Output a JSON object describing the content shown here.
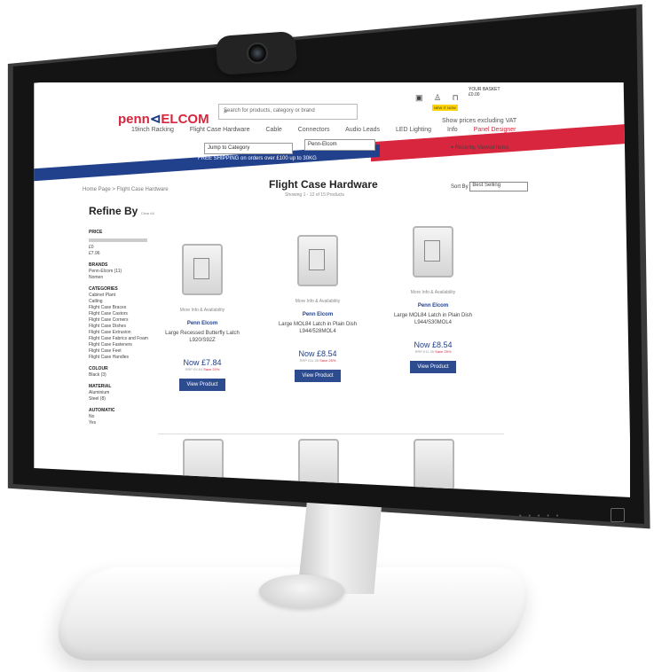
{
  "header": {
    "search_placeholder": "Search for products, category or brand",
    "basket_label": "YOUR BASKET",
    "basket_total": "£0.00",
    "new_badge": "NEW IT NOW",
    "vat_label": "Show prices excluding VAT",
    "recent_label": "▾ Recently Viewed Items"
  },
  "nav": {
    "items": [
      "19inch Racking",
      "Flight Case Hardware",
      "Cable",
      "Connectors",
      "Audio Leads",
      "LED Lighting",
      "Info",
      "Panel Designer"
    ],
    "category_select": "Jump to Category",
    "brand_select": "Penn-Elcom"
  },
  "banner": {
    "text": "FREE SHIPPING on orders over £100 up to 30KG"
  },
  "breadcrumb": "Home Page > Flight Case Hardware",
  "sidebar": {
    "title": "Refine By",
    "clear": "Clear All",
    "sections": [
      {
        "heading": "PRICE",
        "lines": [
          "£0",
          "£7.96"
        ]
      },
      {
        "heading": "BRANDS",
        "lines": [
          "Penn-Elcom (11)",
          "Nomen"
        ]
      },
      {
        "heading": "CATEGORIES",
        "lines": [
          "Cabinet Plant",
          "Catling",
          "Flight Case Braces",
          "Flight Case Castors",
          "Flight Case Corners",
          "Flight Case Dishes",
          "Flight Case Extrusion",
          "Flight Case Fabrics and Foam",
          "Flight Case Fasteners",
          "Flight Case Feet",
          "Flight Case Handles"
        ]
      },
      {
        "heading": "COLOUR",
        "lines": [
          "Black (3)"
        ]
      },
      {
        "heading": "MATERIAL",
        "lines": [
          "Aluminium",
          "Steel (8)"
        ]
      },
      {
        "heading": "AUTOMATIC",
        "lines": [
          "No",
          "Yes"
        ]
      }
    ]
  },
  "main": {
    "title": "Flight Case Hardware",
    "showing": "Showing 1 - 12 of 15 Products",
    "sort_label": "Sort By",
    "sort_value": "Best Selling"
  },
  "products": [
    {
      "more": "More Info & Availability",
      "brand": "Penn Elcom",
      "name": "Large Recessed Butterfly Latch L920/S92Z",
      "price": "Now £7.84",
      "rrp": "RRP £9.84",
      "save": "Save 20%",
      "cta": "View Product"
    },
    {
      "more": "More Info & Availability",
      "brand": "Penn Elcom",
      "name": "Large MOL84 Latch in Plain Dish L944/528MOL4",
      "price": "Now £8.54",
      "rrp": "RRP £11.35",
      "save": "Save 25%",
      "cta": "View Product"
    },
    {
      "more": "More Info & Availability",
      "brand": "Penn Elcom",
      "name": "Large MOL84 Latch in Plain Dish L944/S30MOL4",
      "price": "Now £8.54",
      "rrp": "RRP £11.35",
      "save": "Save 25%",
      "cta": "View Product"
    }
  ]
}
